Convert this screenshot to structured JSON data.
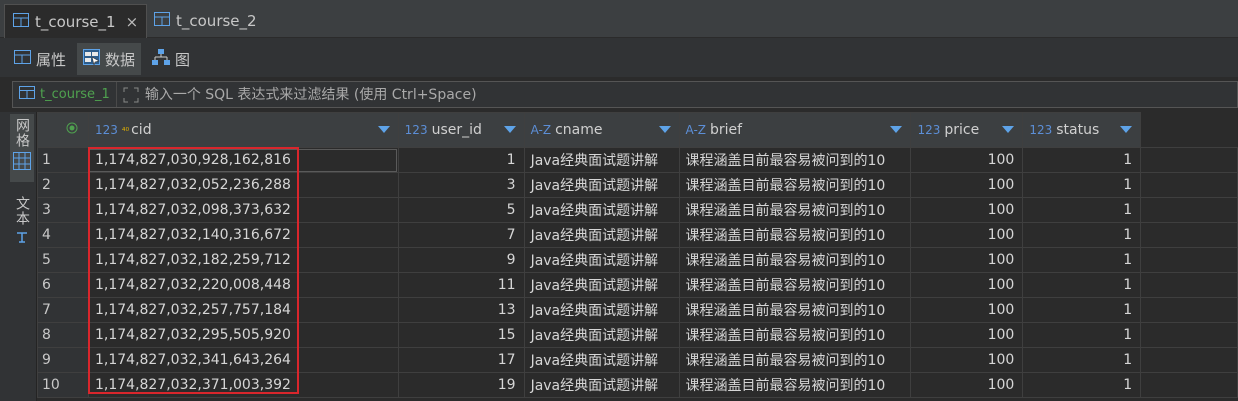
{
  "editor_tabs": [
    {
      "label": "t_course_1",
      "close": "×",
      "active": true
    },
    {
      "label": "t_course_2",
      "active": false
    }
  ],
  "sub_tabs": [
    {
      "label": "属性",
      "icon": "table-icon"
    },
    {
      "label": "数据",
      "icon": "grid-data-icon"
    },
    {
      "label": "图",
      "icon": "er-diagram-icon"
    }
  ],
  "filter": {
    "table": "t_course_1",
    "placeholder": "输入一个 SQL 表达式来过滤结果 (使用 Ctrl+Space)"
  },
  "side_panel": {
    "grid_label": "网格",
    "text_label": "文本"
  },
  "columns": [
    {
      "type": "123",
      "pk": "⁴⁰",
      "name": "cid"
    },
    {
      "type": "123",
      "name": "user_id"
    },
    {
      "type": "A-Z",
      "name": "cname"
    },
    {
      "type": "A-Z",
      "name": "brief"
    },
    {
      "type": "123",
      "name": "price"
    },
    {
      "type": "123",
      "name": "status"
    }
  ],
  "rows": [
    {
      "n": "1",
      "cid": "1,174,827,030,928,162,816",
      "user_id": "1",
      "cname": "Java经典面试题讲解",
      "brief": "课程涵盖目前最容易被问到的10",
      "price": "100",
      "status": "1"
    },
    {
      "n": "2",
      "cid": "1,174,827,032,052,236,288",
      "user_id": "3",
      "cname": "Java经典面试题讲解",
      "brief": "课程涵盖目前最容易被问到的10",
      "price": "100",
      "status": "1"
    },
    {
      "n": "3",
      "cid": "1,174,827,032,098,373,632",
      "user_id": "5",
      "cname": "Java经典面试题讲解",
      "brief": "课程涵盖目前最容易被问到的10",
      "price": "100",
      "status": "1"
    },
    {
      "n": "4",
      "cid": "1,174,827,032,140,316,672",
      "user_id": "7",
      "cname": "Java经典面试题讲解",
      "brief": "课程涵盖目前最容易被问到的10",
      "price": "100",
      "status": "1"
    },
    {
      "n": "5",
      "cid": "1,174,827,032,182,259,712",
      "user_id": "9",
      "cname": "Java经典面试题讲解",
      "brief": "课程涵盖目前最容易被问到的10",
      "price": "100",
      "status": "1"
    },
    {
      "n": "6",
      "cid": "1,174,827,032,220,008,448",
      "user_id": "11",
      "cname": "Java经典面试题讲解",
      "brief": "课程涵盖目前最容易被问到的10",
      "price": "100",
      "status": "1"
    },
    {
      "n": "7",
      "cid": "1,174,827,032,257,757,184",
      "user_id": "13",
      "cname": "Java经典面试题讲解",
      "brief": "课程涵盖目前最容易被问到的10",
      "price": "100",
      "status": "1"
    },
    {
      "n": "8",
      "cid": "1,174,827,032,295,505,920",
      "user_id": "15",
      "cname": "Java经典面试题讲解",
      "brief": "课程涵盖目前最容易被问到的10",
      "price": "100",
      "status": "1"
    },
    {
      "n": "9",
      "cid": "1,174,827,032,341,643,264",
      "user_id": "17",
      "cname": "Java经典面试题讲解",
      "brief": "课程涵盖目前最容易被问到的10",
      "price": "100",
      "status": "1"
    },
    {
      "n": "10",
      "cid": "1,174,827,032,371,003,392",
      "user_id": "19",
      "cname": "Java经典面试题讲解",
      "brief": "课程涵盖目前最容易被问到的10",
      "price": "100",
      "status": "1"
    }
  ],
  "colors": {
    "accent": "#5ea3e8",
    "highlight_box": "#d9262c",
    "table_name": "#4fa14f"
  }
}
